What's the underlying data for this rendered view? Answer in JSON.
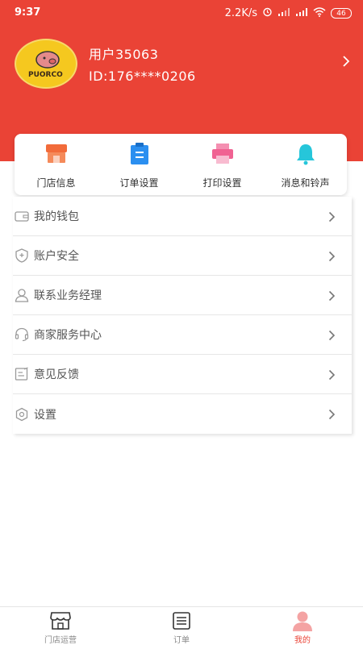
{
  "status_bar": {
    "time": "9:37",
    "network_speed": "2.2K/s",
    "battery": "46",
    "icons": [
      "alarm-icon",
      "signal-icon",
      "signal-icon",
      "wifi-icon",
      "battery-icon"
    ]
  },
  "profile": {
    "avatar_text": "PUORCO",
    "username": "用户35063",
    "user_id": "ID:176****0206"
  },
  "quick_actions": [
    {
      "label": "门店信息",
      "icon": "store-icon",
      "color": "#f26b3a"
    },
    {
      "label": "订单设置",
      "icon": "clipboard-icon",
      "color": "#2b8ff0"
    },
    {
      "label": "打印设置",
      "icon": "printer-icon",
      "color": "#f06292"
    },
    {
      "label": "消息和铃声",
      "icon": "bell-icon",
      "color": "#26c6da"
    }
  ],
  "menu": [
    {
      "label": "我的钱包",
      "icon": "wallet-icon"
    },
    {
      "label": "账户安全",
      "icon": "shield-icon"
    },
    {
      "label": "联系业务经理",
      "icon": "person-icon"
    },
    {
      "label": "商家服务中心",
      "icon": "headset-icon"
    },
    {
      "label": "意见反馈",
      "icon": "feedback-icon"
    },
    {
      "label": "设置",
      "icon": "gear-icon"
    }
  ],
  "bottom_nav": [
    {
      "label": "门店运营",
      "icon": "store-icon",
      "active": false
    },
    {
      "label": "订单",
      "icon": "list-icon",
      "active": false
    },
    {
      "label": "我的",
      "icon": "person-icon",
      "active": true
    }
  ],
  "colors": {
    "header": "#ea4336",
    "active_tab": "#ea4336"
  }
}
